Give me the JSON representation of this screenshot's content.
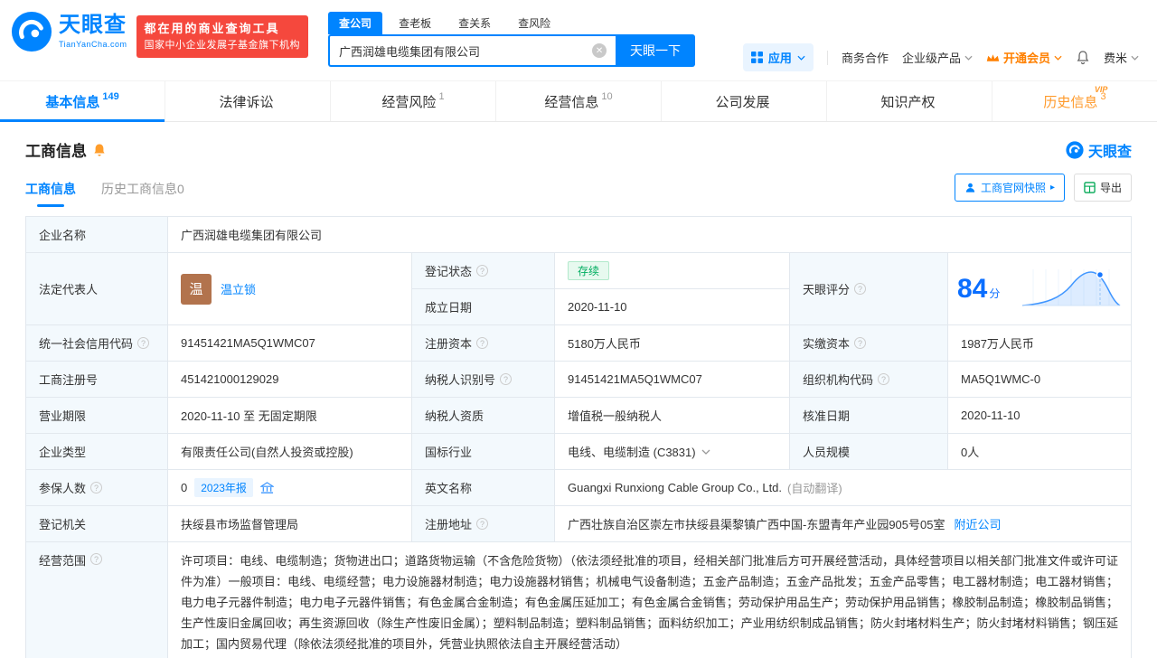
{
  "brand": {
    "logo_text": "天眼查",
    "logo_domain": "TianYanCha.com",
    "banner_line1": "都在用的商业查询工具",
    "banner_line2": "国家中小企业发展子基金旗下机构",
    "watermark": "天眼查"
  },
  "search": {
    "tabs": [
      "查公司",
      "查老板",
      "查关系",
      "查风险"
    ],
    "active_tab": "查公司",
    "value": "广西润雄电缆集团有限公司",
    "button_label": "天眼一下"
  },
  "topnav": {
    "apps": "应用",
    "coop": "商务合作",
    "enterprise": "企业级产品",
    "vip": "开通会员",
    "user": "费米"
  },
  "tabs": [
    {
      "label": "基本信息",
      "count": "149"
    },
    {
      "label": "法律诉讼",
      "count": ""
    },
    {
      "label": "经营风险",
      "count": "1"
    },
    {
      "label": "经营信息",
      "count": "10"
    },
    {
      "label": "公司发展",
      "count": ""
    },
    {
      "label": "知识产权",
      "count": ""
    },
    {
      "label": "历史信息",
      "count": "3",
      "vip": "VIP"
    }
  ],
  "section": {
    "title": "工商信息",
    "subtab_active": "工商信息",
    "subtab_history": "历史工商信息0",
    "snapshot_btn": "工商官网快照",
    "export_btn": "导出"
  },
  "score": {
    "value": "84",
    "unit": "分"
  },
  "company": {
    "name_label": "企业名称",
    "name": "广西润雄电缆集团有限公司",
    "legal_rep_label": "法定代表人",
    "legal_rep_avatar": "温",
    "legal_rep_name": "温立锁",
    "status_label": "登记状态",
    "status": "存续",
    "established_label": "成立日期",
    "established": "2020-11-10",
    "score_label": "天眼评分",
    "credit_code_label": "统一社会信用代码",
    "credit_code": "91451421MA5Q1WMC07",
    "reg_capital_label": "注册资本",
    "reg_capital": "5180万人民币",
    "paid_capital_label": "实缴资本",
    "paid_capital": "1987万人民币",
    "reg_no_label": "工商注册号",
    "reg_no": "451421000129029",
    "taxpayer_no_label": "纳税人识别号",
    "taxpayer_no": "91451421MA5Q1WMC07",
    "org_code_label": "组织机构代码",
    "org_code": "MA5Q1WMC-0",
    "term_label": "营业期限",
    "term": "2020-11-10 至 无固定期限",
    "taxpayer_quality_label": "纳税人资质",
    "taxpayer_quality": "增值税一般纳税人",
    "approved_label": "核准日期",
    "approved": "2020-11-10",
    "type_label": "企业类型",
    "type": "有限责任公司(自然人投资或控股)",
    "industry_label": "国标行业",
    "industry": "电线、电缆制造 (C3831)",
    "staff_label": "人员规模",
    "staff": "0人",
    "insured_label": "参保人数",
    "insured": "0",
    "insured_badge": "2023年报",
    "en_name_label": "英文名称",
    "en_name": "Guangxi Runxiong Cable Group Co., Ltd.",
    "en_name_note": "(自动翻译)",
    "authority_label": "登记机关",
    "authority": "扶绥县市场监督管理局",
    "address_label": "注册地址",
    "address": "广西壮族自治区崇左市扶绥县渠黎镇广西中国-东盟青年产业园905号05室",
    "nearby": "附近公司",
    "scope_label": "经营范围",
    "scope": "许可项目：电线、电缆制造；货物进出口；道路货物运输（不含危险货物）（依法须经批准的项目，经相关部门批准后方可开展经营活动，具体经营项目以相关部门批准文件或许可证件为准）一般项目：电线、电缆经营；电力设施器材制造；电力设施器材销售；机械电气设备制造；五金产品制造；五金产品批发；五金产品零售；电工器材制造；电工器材销售；电力电子元器件制造；电力电子元器件销售；有色金属合金制造；有色金属压延加工；有色金属合金销售；劳动保护用品生产；劳动保护用品销售；橡胶制品制造；橡胶制品销售；生产性废旧金属回收；再生资源回收（除生产性废旧金属）；塑料制品制造；塑料制品销售；面料纺织加工；产业用纺织制成品销售；防火封堵材料生产；防火封堵材料销售；钢压延加工；国内贸易代理（除依法须经批准的项目外，凭营业执照依法自主开展经营活动）"
  },
  "colors": {
    "brand_blue": "#0084ff",
    "vip_orange": "#ff8000",
    "status_green": "#00ad60",
    "banner_red": "#f5483d"
  }
}
